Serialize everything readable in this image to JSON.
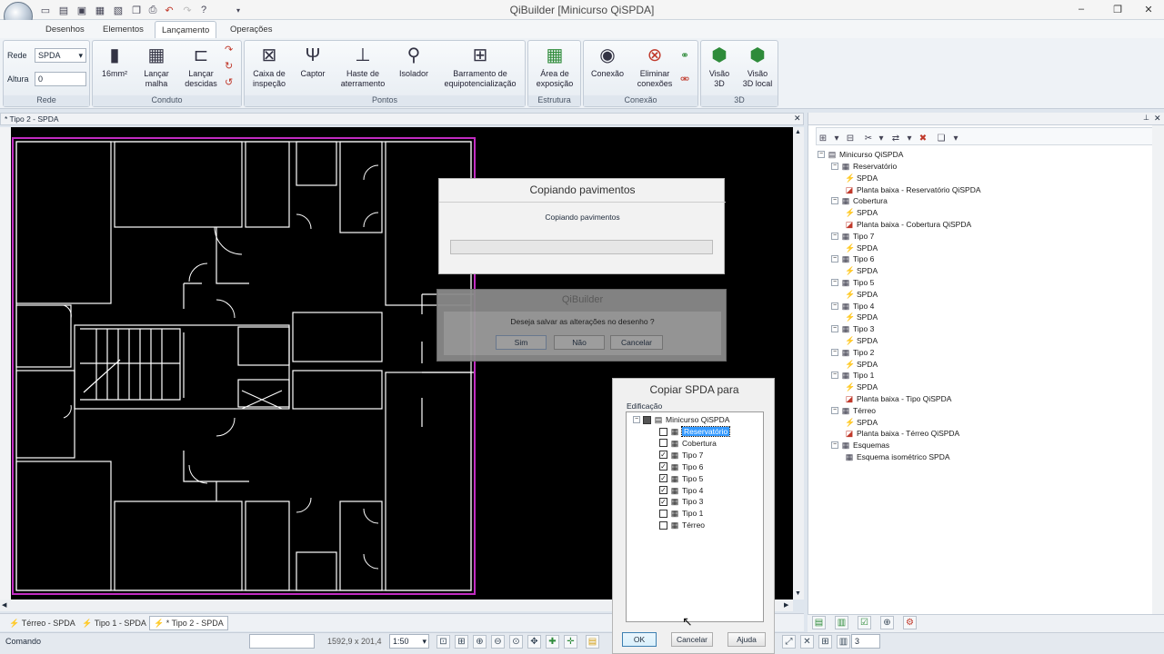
{
  "window": {
    "title": "QiBuilder [Minicurso QiSPDA]"
  },
  "ribbon_tabs": [
    "Desenhos",
    "Elementos",
    "Lançamento",
    "Operações"
  ],
  "ribbon": {
    "rede": {
      "rede_label": "Rede",
      "rede_value": "SPDA",
      "altura_label": "Altura",
      "altura_value": "0",
      "group_title": "Rede"
    },
    "conduto": {
      "b1": "16mm²",
      "b2a": "Lançar",
      "b2b": "malha",
      "b3a": "Lançar",
      "b3b": "descidas",
      "group_title": "Conduto"
    },
    "pontos": {
      "b1a": "Caixa de",
      "b1b": "inspeção",
      "b2": "Captor",
      "b3a": "Haste de",
      "b3b": "aterramento",
      "b4": "Isolador",
      "b5a": "Barramento de",
      "b5b": "equipotencialização",
      "group_title": "Pontos"
    },
    "estrutura": {
      "b1a": "Área de",
      "b1b": "exposição",
      "group_title": "Estrutura"
    },
    "conexao": {
      "b1": "Conexão",
      "b2a": "Eliminar",
      "b2b": "conexões",
      "group_title": "Conexão"
    },
    "d3": {
      "b1a": "Visão",
      "b1b": "3D",
      "b2a": "Visão",
      "b2b": "3D local",
      "group_title": "3D"
    }
  },
  "document_tab": "* Tipo 2 - SPDA",
  "layout_tabs": [
    "Térreo - SPDA",
    "Tipo 1 - SPDA",
    "* Tipo 2 - SPDA"
  ],
  "statusbar": {
    "command_label": "Comando",
    "coords": "1592,9 x 201,4",
    "scale": "1:50",
    "layer_value": "3"
  },
  "tree": {
    "root": "Minicurso QiSPDA",
    "rows": [
      {
        "label": "Reservatório",
        "level": 1
      },
      {
        "label": "SPDA",
        "level": 2
      },
      {
        "label": "Planta baixa - Reservatório QiSPDA",
        "level": 2
      },
      {
        "label": "Cobertura",
        "level": 1
      },
      {
        "label": "SPDA",
        "level": 2
      },
      {
        "label": "Planta baixa - Cobertura QiSPDA",
        "level": 2
      },
      {
        "label": "Tipo 7",
        "level": 1
      },
      {
        "label": "SPDA",
        "level": 2
      },
      {
        "label": "Tipo 6",
        "level": 1
      },
      {
        "label": "SPDA",
        "level": 2
      },
      {
        "label": "Tipo 5",
        "level": 1
      },
      {
        "label": "SPDA",
        "level": 2
      },
      {
        "label": "Tipo 4",
        "level": 1
      },
      {
        "label": "SPDA",
        "level": 2
      },
      {
        "label": "Tipo 3",
        "level": 1
      },
      {
        "label": "SPDA",
        "level": 2
      },
      {
        "label": "Tipo 2",
        "level": 1
      },
      {
        "label": "SPDA",
        "level": 2
      },
      {
        "label": "Tipo 1",
        "level": 1
      },
      {
        "label": "SPDA",
        "level": 2
      },
      {
        "label": "Planta baixa - Tipo QiSPDA",
        "level": 2
      },
      {
        "label": "Térreo",
        "level": 1
      },
      {
        "label": "SPDA",
        "level": 2
      },
      {
        "label": "Planta baixa - Térreo QiSPDA",
        "level": 2
      },
      {
        "label": "Esquemas",
        "level": 1
      },
      {
        "label": "Esquema isométrico SPDA",
        "level": 2
      }
    ]
  },
  "dialog_copying": {
    "title": "Copiando pavimentos",
    "message": "Copiando pavimentos",
    "progress": 0
  },
  "dialog_save": {
    "title": "QiBuilder",
    "message": "Deseja salvar as alterações no desenho ?",
    "yes": "Sim",
    "no": "Não",
    "cancel": "Cancelar"
  },
  "dialog_copy_spda": {
    "title": "Copiar SPDA para",
    "section_label": "Edificação",
    "root": "Minicurso QiSPDA",
    "items": [
      {
        "label": "Reservatório",
        "checked": false
      },
      {
        "label": "Cobertura",
        "checked": false
      },
      {
        "label": "Tipo 7",
        "checked": true
      },
      {
        "label": "Tipo 6",
        "checked": true
      },
      {
        "label": "Tipo 5",
        "checked": true
      },
      {
        "label": "Tipo 4",
        "checked": true
      },
      {
        "label": "Tipo 3",
        "checked": true
      },
      {
        "label": "Tipo 1",
        "checked": false
      },
      {
        "label": "Térreo",
        "checked": false
      }
    ],
    "ok": "OK",
    "cancel": "Cancelar",
    "help": "Ajuda"
  },
  "colors": {
    "canvas_bg": "#000000",
    "boundary": "#c22cc2",
    "walls": "#ffffff",
    "accent": "#3399ff"
  }
}
